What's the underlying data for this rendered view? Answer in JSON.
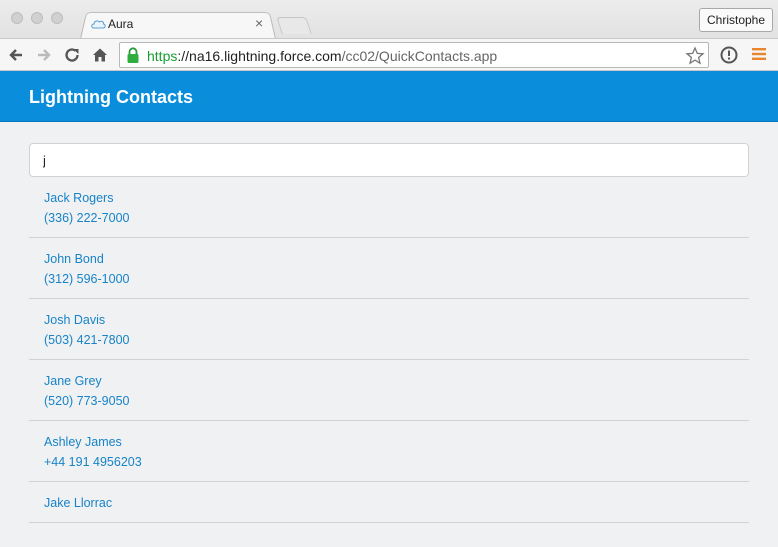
{
  "browser": {
    "tab": {
      "title": "Aura",
      "close_glyph": "×"
    },
    "profile": "Christophe",
    "url": {
      "scheme": "https",
      "separator": "://",
      "host": "na16.lightning.force.com",
      "path": "/cc02/QuickContacts.app"
    },
    "icons": [
      "back-icon",
      "forward-icon",
      "reload-icon",
      "home-icon",
      "lock-icon",
      "star-icon",
      "info-icon",
      "menu-icon"
    ]
  },
  "app": {
    "title": "Lightning Contacts",
    "search": {
      "value": "j",
      "placeholder": ""
    },
    "contacts": [
      {
        "name": "Jack Rogers",
        "phone": "(336) 222-7000"
      },
      {
        "name": "John Bond",
        "phone": "(312) 596-1000"
      },
      {
        "name": "Josh Davis",
        "phone": "(503) 421-7800"
      },
      {
        "name": "Jane Grey",
        "phone": "(520) 773-9050"
      },
      {
        "name": "Ashley James",
        "phone": "+44 191 4956203"
      },
      {
        "name": "Jake Llorrac",
        "phone": ""
      }
    ]
  },
  "colors": {
    "header": "#0a8ddb",
    "link": "#1783c8",
    "secure": "#1a9e32",
    "menu": "#e8852e"
  }
}
